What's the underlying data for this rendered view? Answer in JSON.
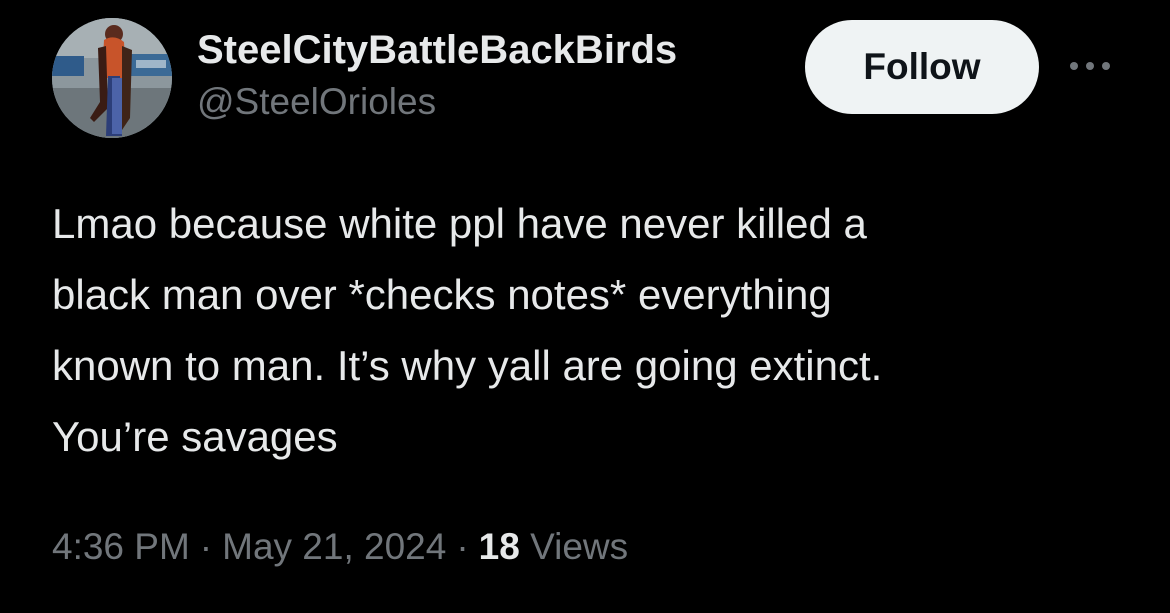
{
  "author": {
    "display_name": "SteelCityBattleBackBirds",
    "handle": "@SteelOrioles"
  },
  "follow_label": "Follow",
  "more_icon": "ellipsis-icon",
  "tweet": {
    "lines": [
      "Lmao because white ppl have never killed a",
      "black man over *checks notes* everything",
      "known to man. It’s why yall are going extinct.",
      "You’re savages"
    ]
  },
  "meta": {
    "time": "4:36 PM",
    "separator": "·",
    "date": "May 21, 2024",
    "views_count": "18",
    "views_label": "Views"
  },
  "colors": {
    "background": "#000000",
    "primary_text": "#e7e9ea",
    "secondary_text": "#71767b",
    "follow_bg": "#eff3f4",
    "follow_text": "#0f1419"
  }
}
